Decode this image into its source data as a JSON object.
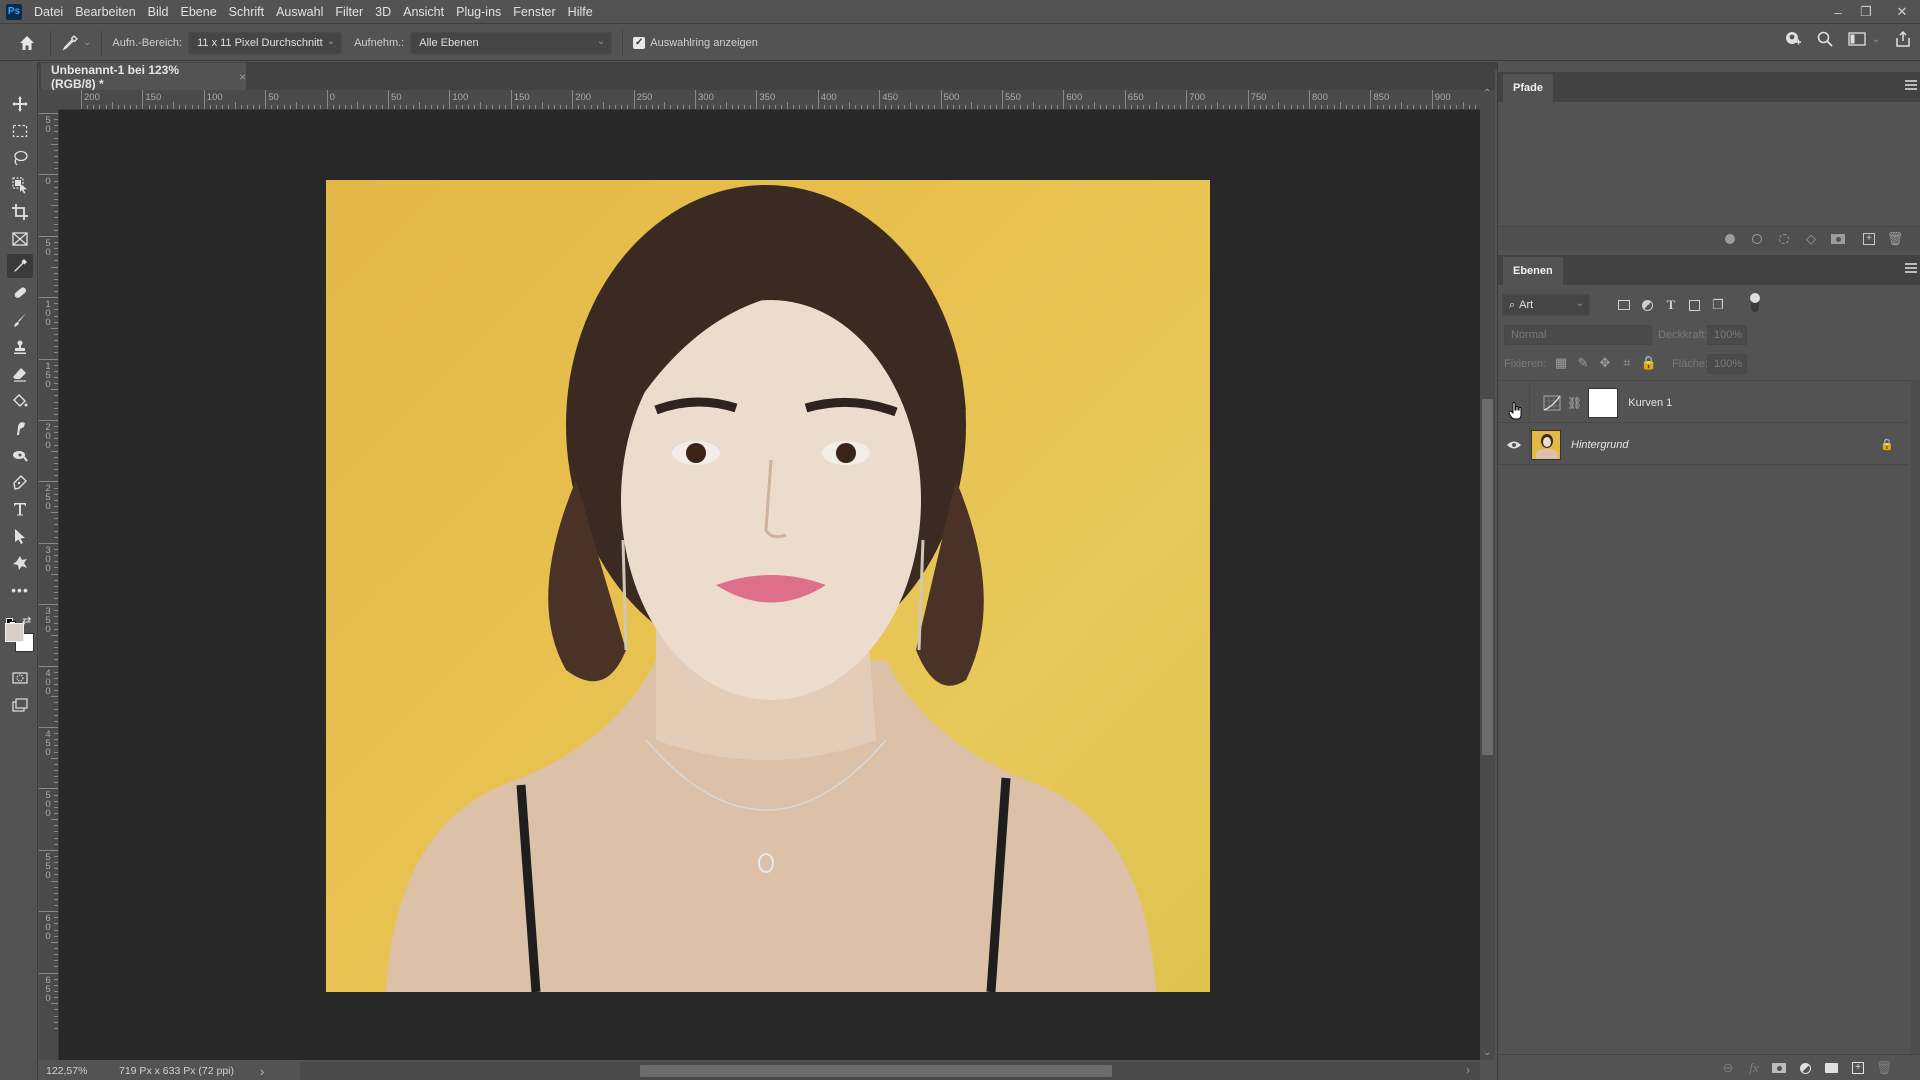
{
  "app": {
    "logo": "Ps"
  },
  "menu": [
    "Datei",
    "Bearbeiten",
    "Bild",
    "Ebene",
    "Schrift",
    "Auswahl",
    "Filter",
    "3D",
    "Ansicht",
    "Plug-ins",
    "Fenster",
    "Hilfe"
  ],
  "window_controls": {
    "minimize": "–",
    "restore": "❐",
    "close": "✕"
  },
  "options_bar": {
    "sample_size_label": "Aufn.-Bereich:",
    "sample_size_value": "11 x 11 Pixel Durchschnitt",
    "sample_label": "Aufnehm.:",
    "sample_value": "Alle Ebenen",
    "show_ring_label": "Auswahlring anzeigen",
    "show_ring_checked": true
  },
  "document": {
    "tab_title": "Unbenannt-1 bei 123% (RGB/8) *",
    "close": "×",
    "h_ruler_labels": [
      "200",
      "150",
      "100",
      "50",
      "0",
      "50",
      "100",
      "150",
      "200",
      "250",
      "300",
      "350",
      "400",
      "450",
      "500",
      "550",
      "600",
      "650",
      "700",
      "750",
      "800",
      "850",
      "900"
    ],
    "v_ruler_labels": [
      "50",
      "0",
      "50",
      "100",
      "150",
      "200",
      "250",
      "300",
      "350",
      "400",
      "450",
      "500",
      "550",
      "600",
      "650"
    ],
    "photo_background_color": "#e3b847"
  },
  "status": {
    "zoom": "122,57%",
    "dimensions": "719 Px x 633 Px (72 ppi)",
    "arrow": "›",
    "left_arrow": "‹"
  },
  "tools": [
    "move-tool",
    "marquee-tool",
    "lasso-tool",
    "object-selection-tool",
    "crop-tool",
    "frame-tool",
    "eyedropper-tool",
    "healing-brush-tool",
    "brush-tool",
    "clone-stamp-tool",
    "eraser-tool",
    "paint-bucket-tool",
    "smudge-tool",
    "dodge-tool",
    "pen-tool",
    "type-tool",
    "path-selection-tool",
    "custom-shape-tool",
    "more-tools"
  ],
  "colors": {
    "foreground": "#d8d0c8",
    "background": "#ffffff"
  },
  "paths_panel": {
    "tab": "Pfade"
  },
  "layers_panel": {
    "tab": "Ebenen",
    "filter_label": "Art",
    "blend_mode": "Normal",
    "opacity_label": "Deckkraft:",
    "opacity_value": "100%",
    "lock_label": "Fixieren:",
    "fill_label": "Fläche:",
    "fill_value": "100%",
    "layers": [
      {
        "name": "Kurven 1",
        "type": "curves-adjustment",
        "visible": false,
        "italic": false
      },
      {
        "name": "Hintergrund",
        "type": "image",
        "visible": true,
        "italic": true,
        "locked": true
      }
    ]
  }
}
